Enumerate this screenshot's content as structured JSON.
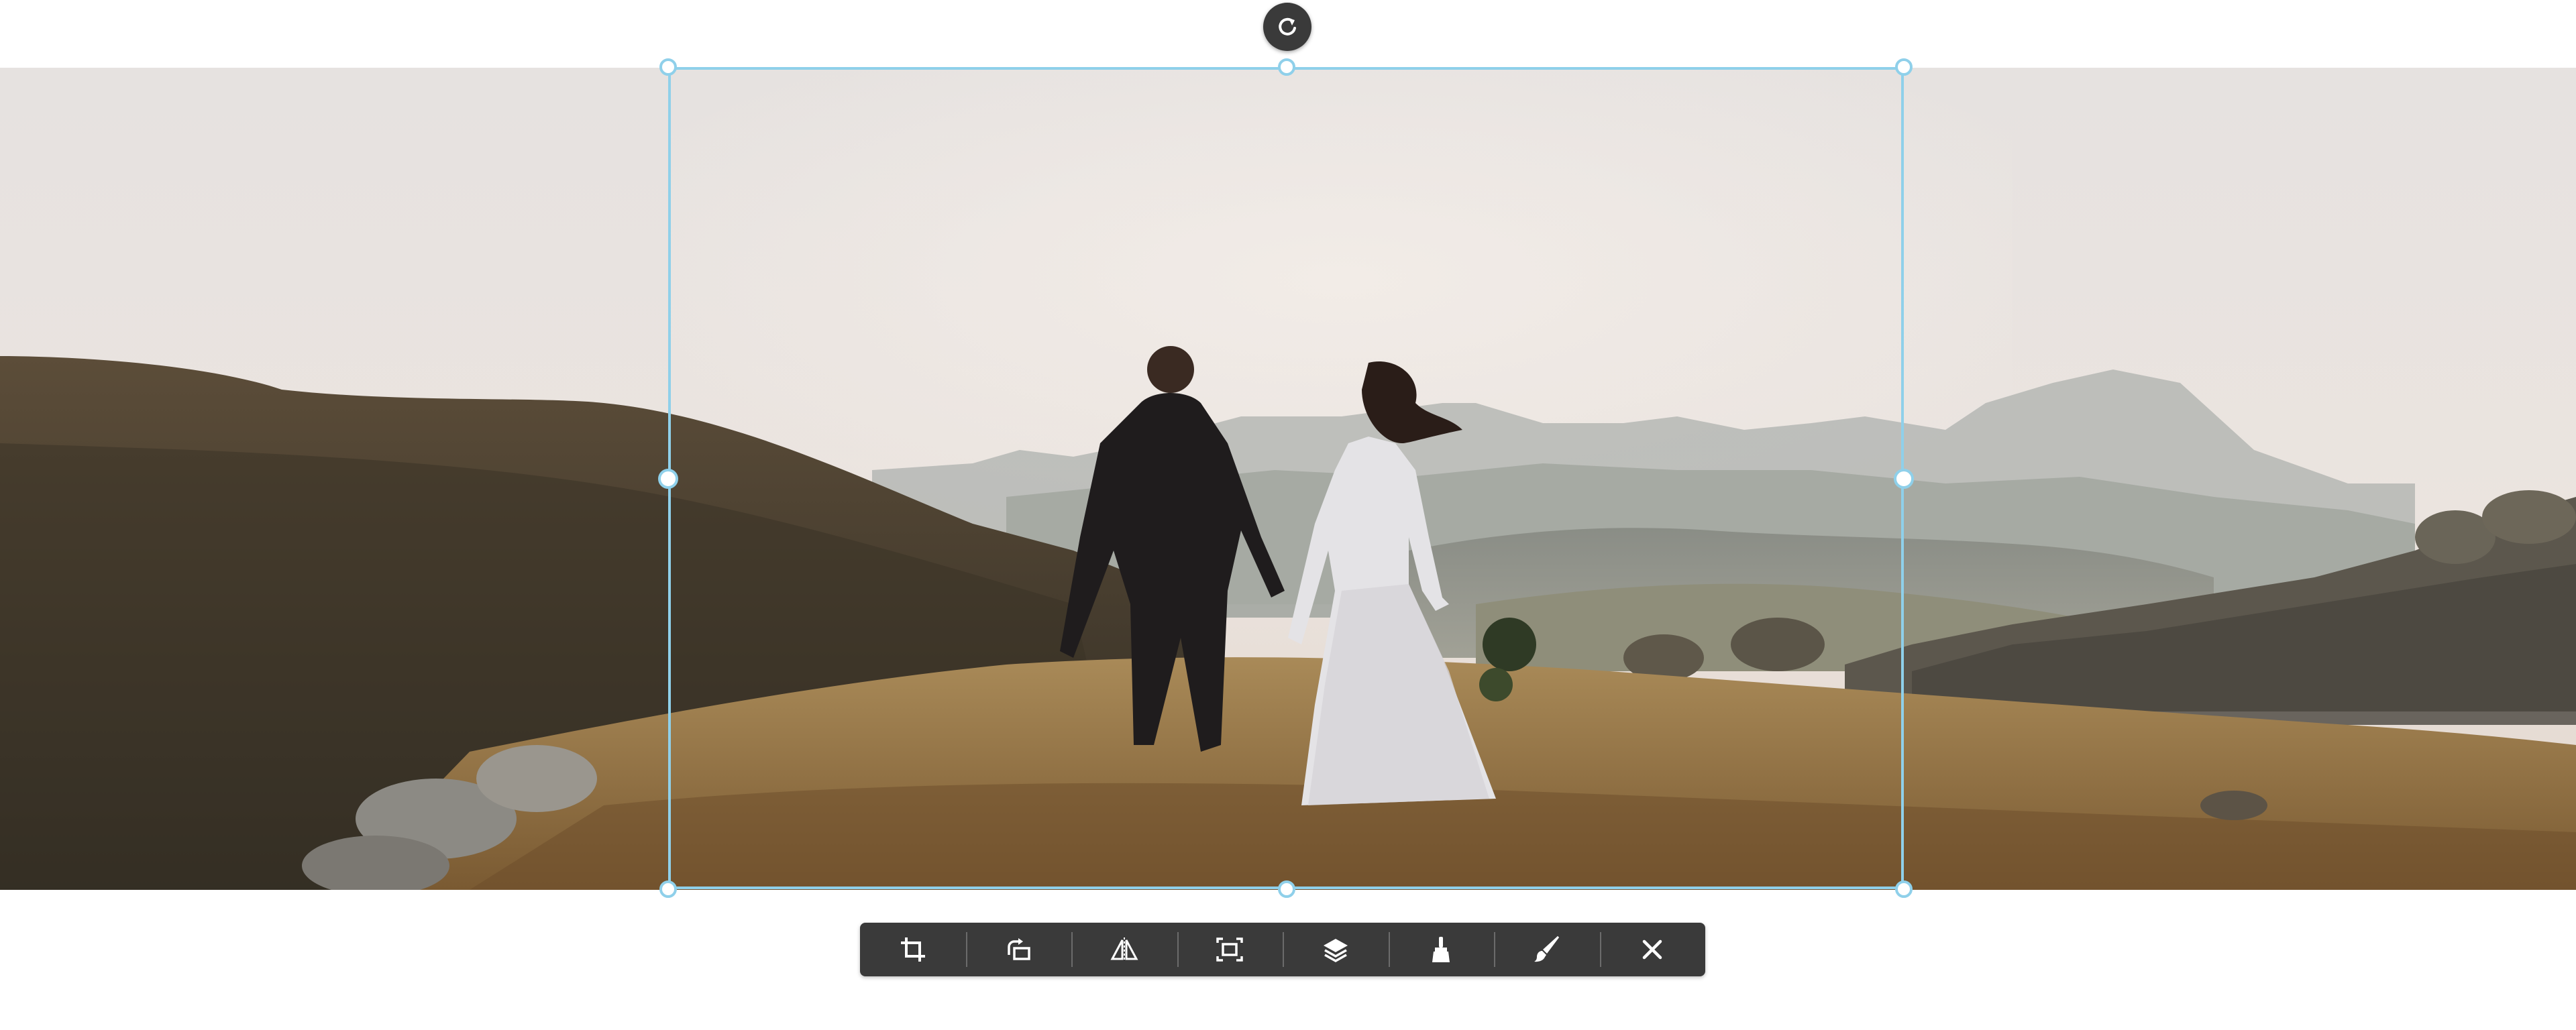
{
  "editor": {
    "photo_icon": "wedding-photo",
    "rotate_icon": "rotate-icon",
    "frame_color": "#8fd0ea",
    "toolbar_color": "#3a3a3a"
  },
  "toolbar": {
    "tools": [
      {
        "icon": "crop-icon"
      },
      {
        "icon": "rotate-aspect-icon"
      },
      {
        "icon": "flip-icon"
      },
      {
        "icon": "fit-icon"
      },
      {
        "icon": "layers-icon"
      },
      {
        "icon": "broom-icon"
      },
      {
        "icon": "brush-icon"
      },
      {
        "icon": "close-icon"
      }
    ]
  }
}
